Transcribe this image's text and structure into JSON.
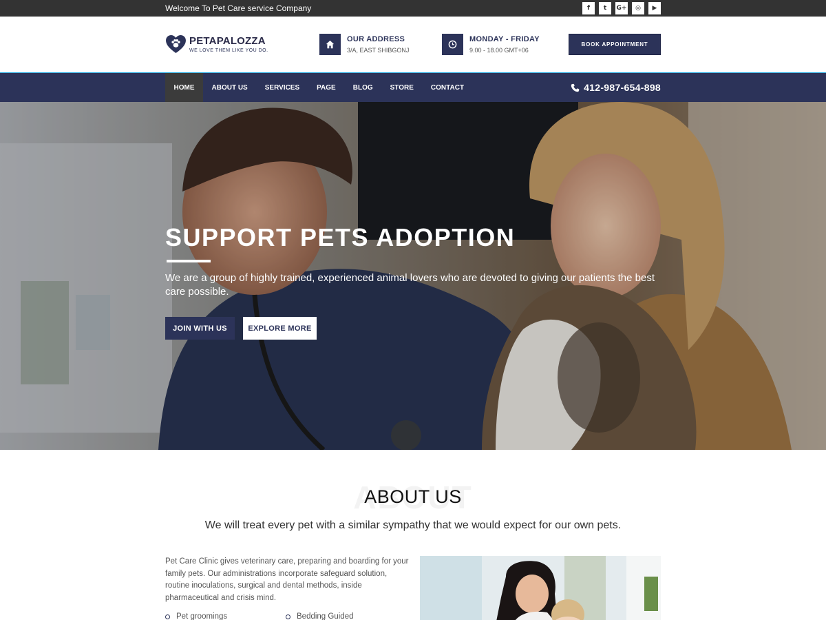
{
  "topbar": {
    "welcome": "Welcome To Pet Care service Company",
    "social": [
      {
        "icon": "facebook-icon",
        "glyph": "f"
      },
      {
        "icon": "twitter-icon",
        "glyph": "t"
      },
      {
        "icon": "google-plus-icon",
        "glyph": "G+"
      },
      {
        "icon": "instagram-icon",
        "glyph": "◎"
      },
      {
        "icon": "youtube-icon",
        "glyph": "▶"
      }
    ]
  },
  "header": {
    "logo_name": "PETAPALOZZA",
    "logo_tagline": "WE LOVE THEM LIKE YOU DO.",
    "address_title": "OUR ADDRESS",
    "address_value": "3/A, EAST SHIBGONJ",
    "hours_title": "MONDAY - FRIDAY",
    "hours_value": "9.00 - 18.00 GMT+06",
    "book_label": "BOOK APPOINTMENT"
  },
  "nav": {
    "items": [
      "HOME",
      "ABOUT US",
      "SERVICES",
      "PAGE",
      "BLOG",
      "STORE",
      "CONTACT"
    ],
    "active": "HOME",
    "phone": "412-987-654-898"
  },
  "hero": {
    "title": "SUPPORT PETS ADOPTION",
    "text": "We are a group of highly trained, experienced animal lovers who are devoted to giving our patients the best care possible.",
    "join_label": "JOIN WITH US",
    "explore_label": "EXPLORE MORE"
  },
  "about": {
    "ghost": "ABOUT",
    "title": "ABOUT US",
    "subtitle": "We will treat every pet with a similar sympathy that we would expect for our own pets.",
    "paragraph": "Pet Care Clinic gives veterinary care, preparing and boarding for your family pets. Our administrations incorporate safeguard solution, routine inoculations, surgical and dental methods, inside pharmaceutical and crisis mind.",
    "list": [
      "Pet groomings",
      "Bedding Guided"
    ]
  },
  "colors": {
    "primary": "#2c3359",
    "topbar": "#333333",
    "nav_active": "#3b3b3b",
    "accent_line": "#26ace2"
  }
}
